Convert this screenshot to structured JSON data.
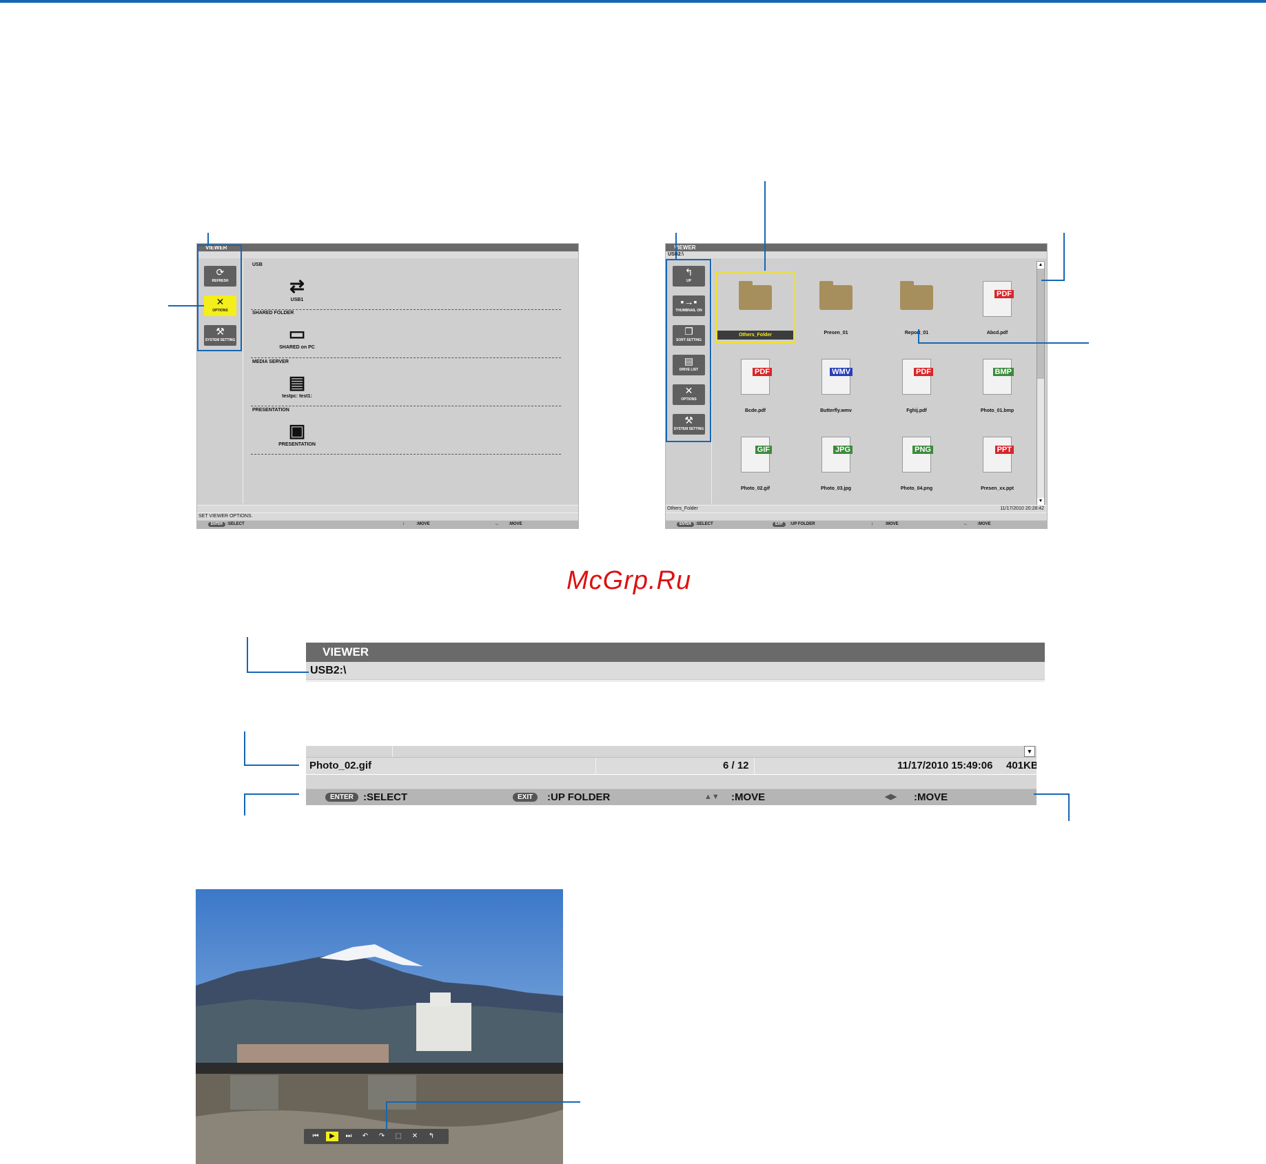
{
  "watermark": "McGrp.Ru",
  "viewer_left": {
    "title": "VIEWER",
    "sidebar": [
      {
        "label": "REFRESH",
        "icon": "refresh-icon"
      },
      {
        "label": "OPTIONS",
        "icon": "tools-icon"
      },
      {
        "label": "SYSTEM SETTING",
        "icon": "system-setting-icon"
      }
    ],
    "sections": [
      {
        "heading": "USB",
        "item": "USB1",
        "icon": "usb-icon"
      },
      {
        "heading": "SHARED FOLDER",
        "item": "SHARED on PC",
        "icon": "pc-icon"
      },
      {
        "heading": "MEDIA SERVER",
        "item": "testpc: test1:",
        "icon": "media-server-icon"
      },
      {
        "heading": "PRESENTATION",
        "item": "PRESENTATION",
        "icon": "presentation-icon"
      }
    ],
    "status": "SET VIEWER OPTIONS.",
    "footer": {
      "select_key": "ENTER",
      "select": ":SELECT",
      "move1": ":MOVE",
      "move2": ":MOVE"
    }
  },
  "viewer_right": {
    "title": "VIEWER",
    "path": "USB2:\\",
    "sidebar": [
      {
        "label": "UP",
        "icon": "up-icon"
      },
      {
        "label": "THUMBNAIL ON",
        "icon": "thumbnail-icon"
      },
      {
        "label": "SORT SETTING",
        "icon": "sort-icon"
      },
      {
        "label": "DRIVE LIST",
        "icon": "drive-list-icon"
      },
      {
        "label": "OPTIONS",
        "icon": "tools-icon"
      },
      {
        "label": "SYSTEM SETTING",
        "icon": "system-setting-icon"
      }
    ],
    "files": [
      {
        "name": "Others_Folder",
        "kind": "folder"
      },
      {
        "name": "Presen_01",
        "kind": "folder"
      },
      {
        "name": "Report_01",
        "kind": "folder"
      },
      {
        "name": "Abcd.pdf",
        "kind": "PDF",
        "color": "#d8262b"
      },
      {
        "name": "Bcde.pdf",
        "kind": "PDF",
        "color": "#d8262b"
      },
      {
        "name": "Butterfly.wmv",
        "kind": "WMV",
        "color": "#2a3fb8"
      },
      {
        "name": "Fghij.pdf",
        "kind": "PDF",
        "color": "#d8262b"
      },
      {
        "name": "Photo_01.bmp",
        "kind": "BMP",
        "color": "#3c8a3c"
      },
      {
        "name": "Photo_02.gif",
        "kind": "GIF",
        "color": "#3c8a3c"
      },
      {
        "name": "Photo_03.jpg",
        "kind": "JPG",
        "color": "#3c8a3c"
      },
      {
        "name": "Photo_04.png",
        "kind": "PNG",
        "color": "#3c8a3c"
      },
      {
        "name": "Presen_xx.ppt",
        "kind": "PPT",
        "color": "#d8262b"
      }
    ],
    "status_name": "Others_Folder",
    "status_date": "11/17/2010  20:28:42",
    "footer": {
      "select_key": "ENTER",
      "select": ":SELECT",
      "exit_key": "EXIT",
      "up": ":UP FOLDER",
      "move1": ":MOVE",
      "move2": ":MOVE"
    }
  },
  "zoom_header": {
    "title": "VIEWER",
    "path": "USB2:\\"
  },
  "zoom_footer": {
    "filename": "Photo_02.gif",
    "count": "6 / 12",
    "date": "11/17/2010  15:49:06",
    "size": "401KB",
    "enter_key": "ENTER",
    "select": ":SELECT",
    "exit_key": "EXIT",
    "up": ":UP FOLDER",
    "move1": ":MOVE",
    "move2": ":MOVE"
  },
  "photo_toolbar": [
    "prev-icon",
    "play-icon",
    "next-icon",
    "rotate-left-icon",
    "rotate-right-icon",
    "fit-icon",
    "close-icon",
    "up-icon"
  ]
}
